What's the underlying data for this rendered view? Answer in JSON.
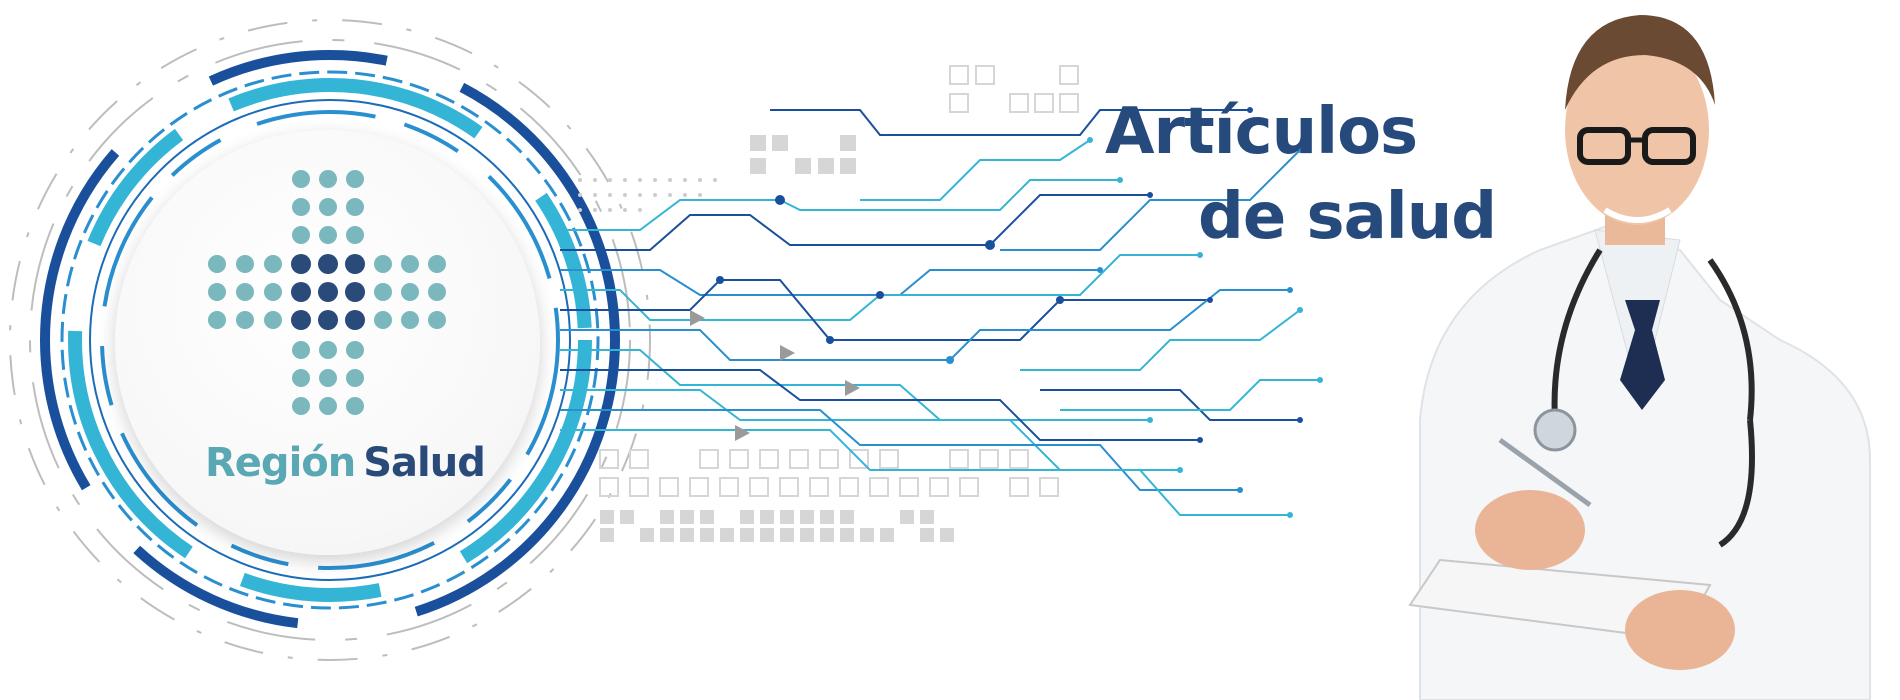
{
  "logo": {
    "word1": "Región",
    "word2": "Salud",
    "icon": "medical-cross-dots-icon",
    "colors": {
      "light_teal": "#7ab8be",
      "dark_navy": "#2a4a7a"
    }
  },
  "headline": {
    "line1": "Artículos",
    "line2": "de salud",
    "color": "#274a7c"
  },
  "illustration": {
    "subject": "doctor-photo",
    "decor": "circuit-lines"
  },
  "colors": {
    "blue_dark": "#1a4f9c",
    "blue_mid": "#2a8fcf",
    "cyan": "#35b5d6",
    "gray_lines": "#b8b8b8"
  }
}
